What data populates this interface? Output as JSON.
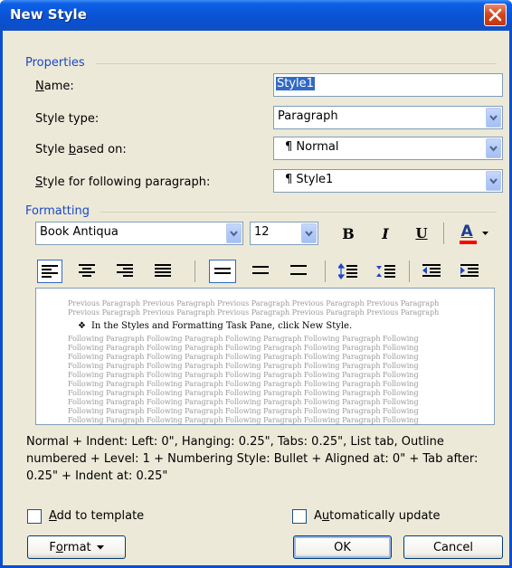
{
  "window": {
    "title": "New Style"
  },
  "properties": {
    "legend": "Properties",
    "name_label_key": "N",
    "name_label_rest": "ame:",
    "name_value": "Style1",
    "type_label": "Style type:",
    "type_value": "Paragraph",
    "based_label_pre": "Style ",
    "based_label_key": "b",
    "based_label_post": "ased on:",
    "based_value": "¶ Normal",
    "following_label_key": "S",
    "following_label_rest": "tyle for following paragraph:",
    "following_value": "¶ Style1"
  },
  "formatting": {
    "legend": "Formatting",
    "font": "Book Antiqua",
    "size": "12",
    "bold": "B",
    "italic": "I",
    "underline": "U",
    "font_color": "A"
  },
  "preview": {
    "previous_line": "Previous Paragraph Previous Paragraph Previous Paragraph Previous Paragraph Previous Paragraph",
    "main_text": "In the Styles and Formatting Task Pane, click New Style.",
    "following_line": "Following Paragraph Following Paragraph Following Paragraph Following Paragraph Following"
  },
  "description": "Normal + Indent: Left:  0\", Hanging:  0.25\", Tabs:  0.25\", List tab, Outline numbered + Level: 1 + Numbering Style: Bullet + Aligned at:  0\" + Tab after:  0.25\" + Indent at:  0.25\"",
  "options": {
    "add_template_key": "A",
    "add_template_rest": "dd to template",
    "auto_update_pre": "A",
    "auto_update_key": "u",
    "auto_update_rest": "tomatically update"
  },
  "buttons": {
    "format_pre": "F",
    "format_key": "o",
    "format_rest": "rmat",
    "ok": "OK",
    "cancel": "Cancel"
  },
  "colors": {
    "title_bar": "#0a54d6",
    "close_button": "#d5471f",
    "legend_text": "#1c48c6",
    "dialog_bg": "#ece9d8",
    "font_color_bar": "#ff0000"
  }
}
